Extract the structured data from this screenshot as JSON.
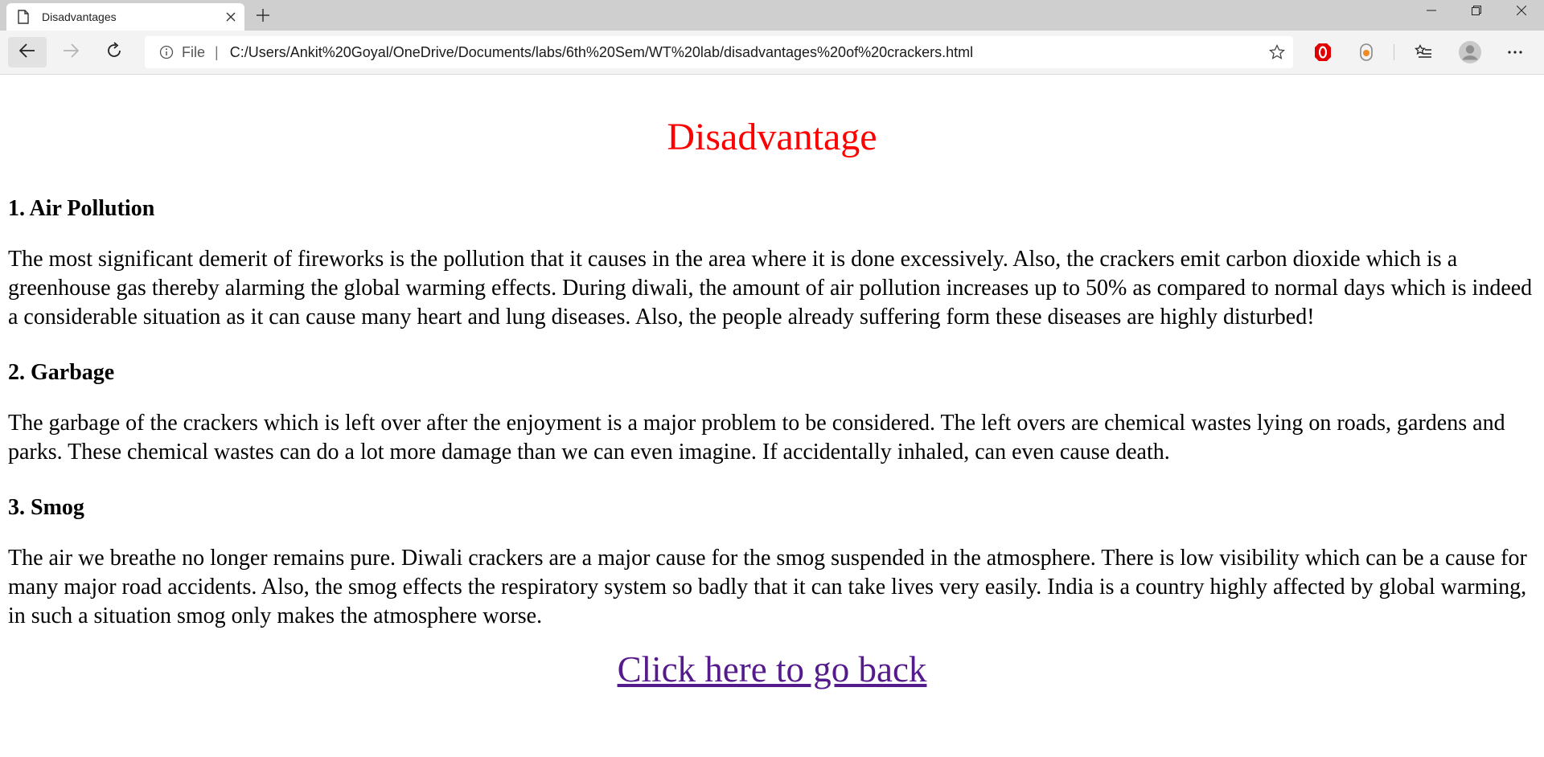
{
  "browser": {
    "tab_title": "Disadvantages",
    "address": {
      "scheme_label": "File",
      "url": "C:/Users/Ankit%20Goyal/OneDrive/Documents/labs/6th%20Sem/WT%20lab/disadvantages%20of%20crackers.html"
    },
    "icons": {
      "favicon": "page-icon",
      "close": "close-icon",
      "new_tab": "plus-icon",
      "back": "back-arrow-icon",
      "forward": "forward-arrow-icon",
      "refresh": "refresh-icon",
      "info": "info-icon",
      "favorite": "star-icon",
      "ext1": "opera-o-icon",
      "ext2": "extension-icon",
      "favorites_list": "favorites-list-icon",
      "profile": "avatar-icon",
      "more": "more-icon"
    }
  },
  "page": {
    "title": "Disadvantage",
    "sections": [
      {
        "heading": "1. Air Pollution",
        "body": "The most significant demerit of fireworks is the pollution that it causes in the area where it is done excessively. Also, the crackers emit carbon dioxide which is a greenhouse gas thereby alarming the global warming effects. During diwali, the amount of air pollution increases up to 50% as compared to normal days which is indeed a considerable situation as it can cause many heart and lung diseases. Also, the people already suffering form these diseases are highly disturbed!"
      },
      {
        "heading": "2. Garbage",
        "body": "The garbage of the crackers which is left over after the enjoyment is a major problem to be considered. The left overs are chemical wastes lying on roads, gardens and parks. These chemical wastes can do a lot more damage than we can even imagine. If accidentally inhaled, can even cause death."
      },
      {
        "heading": "3. Smog",
        "body": "The air we breathe no longer remains pure. Diwali crackers are a major cause for the smog suspended in the atmosphere. There is low visibility which can be a cause for many major road accidents. Also, the smog effects the respiratory system so badly that it can take lives very easily. India is a country highly affected by global warming, in such a situation smog only makes the atmosphere worse."
      }
    ],
    "back_link": "Click here to go back"
  },
  "colors": {
    "title": "#ff0000",
    "link_visited": "#551a8b",
    "tabstrip": "#cfcfcf",
    "toolbar": "#f3f3f3"
  }
}
